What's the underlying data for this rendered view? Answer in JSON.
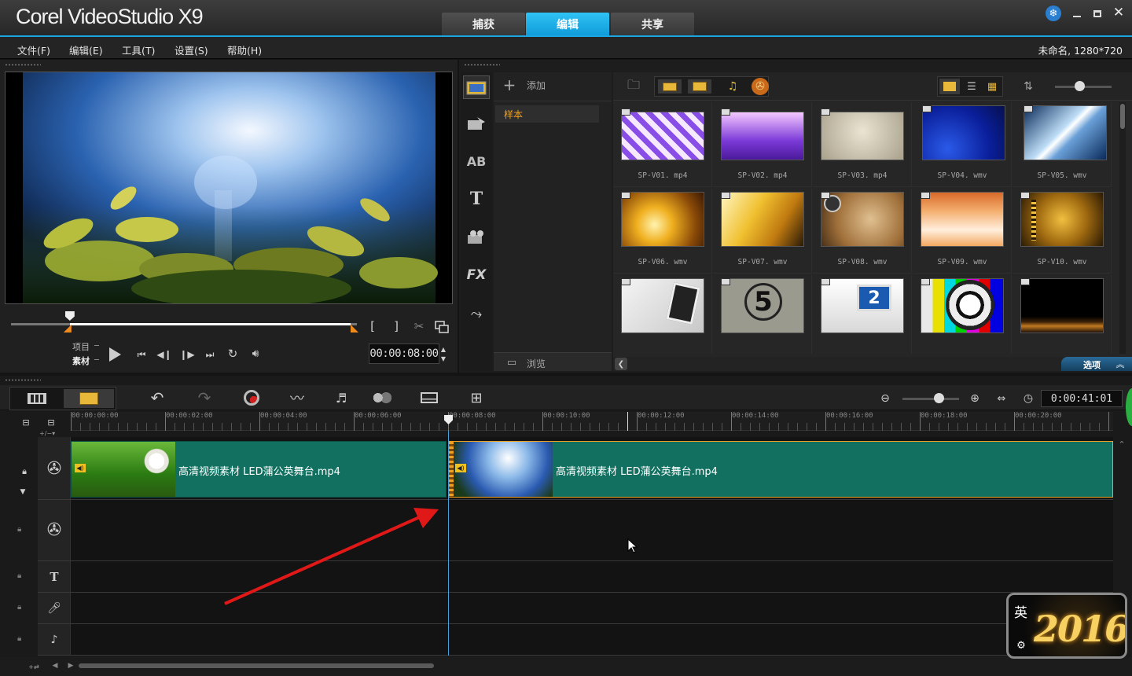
{
  "titlebar": {
    "brand": "Corel VideoStudio X9",
    "tabs": [
      {
        "label": "捕获",
        "active": false
      },
      {
        "label": "编辑",
        "active": true
      },
      {
        "label": "共享",
        "active": false
      }
    ]
  },
  "menu": {
    "items": [
      "文件(F)",
      "编辑(E)",
      "工具(T)",
      "设置(S)",
      "帮助(H)"
    ],
    "project_info": "未命名, 1280*720"
  },
  "preview": {
    "mode_project": "项目",
    "mode_clip": "素材",
    "timecode": "00:00:08:00",
    "scrub_progress": 0.17
  },
  "library": {
    "add_label": "添加",
    "folder": "样本",
    "browse_label": "浏览",
    "options_label": "选项",
    "thumbnails": [
      {
        "name": "SP-V01. mp4",
        "icon": "purple-tiles-thumb"
      },
      {
        "name": "SP-V02. mp4",
        "icon": "purple-stage-thumb"
      },
      {
        "name": "SP-V03. mp4",
        "icon": "beige-gradient-thumb"
      },
      {
        "name": "SP-V04. wmv",
        "icon": "blue-wave-thumb"
      },
      {
        "name": "SP-V05. wmv",
        "icon": "blue-light-thumb"
      },
      {
        "name": "SP-V06. wmv",
        "icon": "gold-bokeh-thumb"
      },
      {
        "name": "SP-V07. wmv",
        "icon": "gold-rays-thumb"
      },
      {
        "name": "SP-V08. wmv",
        "icon": "old-paper-thumb"
      },
      {
        "name": "SP-V09. wmv",
        "icon": "orange-glow-thumb"
      },
      {
        "name": "SP-V10. wmv",
        "icon": "film-strip-thumb"
      },
      {
        "name": "",
        "icon": "photo-frame-thumb"
      },
      {
        "name": "",
        "icon": "countdown-thumb"
      },
      {
        "name": "",
        "icon": "monitor-2-thumb"
      },
      {
        "name": "",
        "icon": "test-pattern-thumb"
      },
      {
        "name": "",
        "icon": "night-city-thumb"
      }
    ]
  },
  "timeline": {
    "duration": "0:00:41:01",
    "ruler": [
      "00:00:00:00",
      "00:00:02:00",
      "00:00:04:00",
      "00:00:06:00",
      "00:00:08:00",
      "00:00:10:00",
      "00:00:12:00",
      "00:00:14:00",
      "00:00:16:00",
      "00:00:18:00",
      "00:00:20:00"
    ],
    "clips": [
      {
        "name": "高清视频素材 LED蒲公英舞台.mp4",
        "thumb": "dandelion-thumb"
      },
      {
        "name": "高清视频素材 LED蒲公英舞台.mp4",
        "thumb": "blue-plants-thumb"
      }
    ]
  },
  "overlay": {
    "ime_label": "英",
    "badge_text": "2016"
  },
  "colors": {
    "accent": "#19a6e3",
    "clip": "#117060",
    "annotation_arrow": "#e01818"
  }
}
